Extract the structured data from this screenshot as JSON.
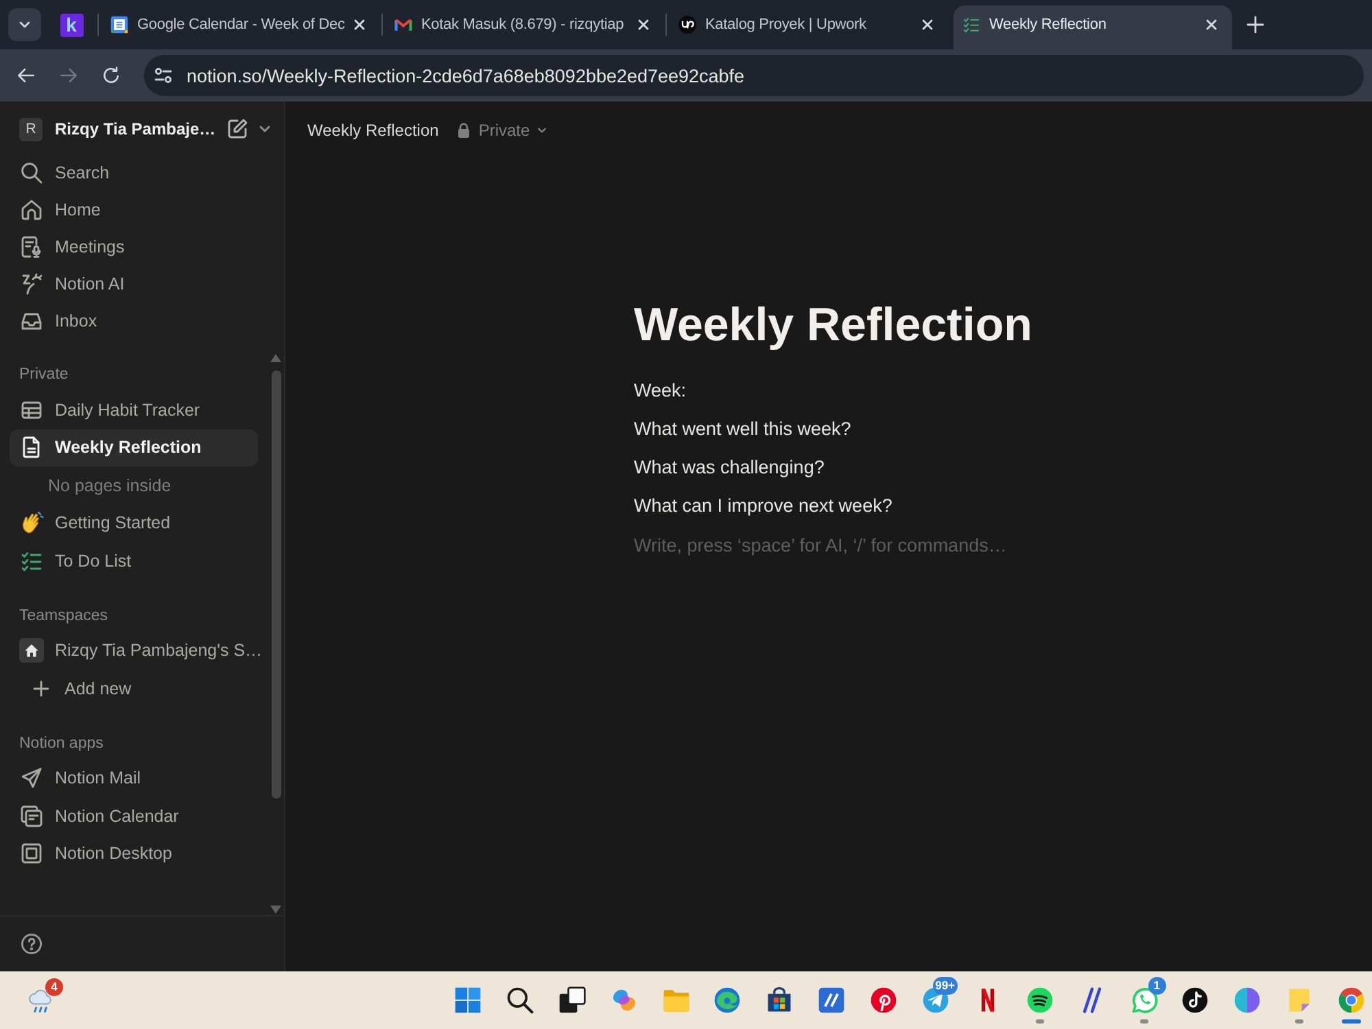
{
  "browser": {
    "tabs": [
      {
        "kind": "pinned",
        "logo_text": "k",
        "selected": false
      },
      {
        "kind": "page",
        "title": "Google Calendar - Week of Dec",
        "selected": false
      },
      {
        "kind": "page",
        "title": "Kotak Masuk (8.679) - rizqytiap",
        "selected": false
      },
      {
        "kind": "page",
        "title": "Katalog Proyek | Upwork",
        "selected": false
      },
      {
        "kind": "page",
        "title": "Weekly Reflection",
        "selected": true
      }
    ],
    "nav_buttons": [
      {
        "kind": "back",
        "disabled": false
      },
      {
        "kind": "forward",
        "disabled": true
      },
      {
        "kind": "reload",
        "disabled": false
      }
    ],
    "url": "notion.so/Weekly-Reflection-2cde6d7a68eb8092bbe2ed7ee92cabfe"
  },
  "sidebar": {
    "workspace": {
      "initial": "R",
      "name": "Rizqy Tia Pambaje…"
    },
    "nav": [
      {
        "label": "Search",
        "selected": false
      },
      {
        "label": "Home",
        "selected": false
      },
      {
        "label": "Meetings",
        "selected": false
      },
      {
        "label": "Notion AI",
        "selected": false
      },
      {
        "label": "Inbox",
        "selected": false
      }
    ],
    "sections": [
      {
        "title": "Private",
        "items": [
          {
            "kind": "entry",
            "label": "Daily Habit Tracker",
            "selected": false
          },
          {
            "kind": "entry",
            "label": "Weekly Reflection",
            "selected": true,
            "empty_note": "No pages inside"
          },
          {
            "kind": "entry",
            "label": "Getting Started",
            "selected": false
          },
          {
            "kind": "entry",
            "label": "To Do List",
            "selected": false
          }
        ]
      },
      {
        "title": "Teamspaces",
        "items": [
          {
            "kind": "entry",
            "label": "Rizqy Tia Pambajeng's S…",
            "selected": false
          },
          {
            "kind": "action",
            "label": "Add new",
            "selected": false
          }
        ]
      },
      {
        "title": "Notion apps",
        "items": [
          {
            "kind": "entry",
            "label": "Notion Mail",
            "selected": false
          },
          {
            "kind": "entry",
            "label": "Notion Calendar",
            "selected": false
          },
          {
            "kind": "entry",
            "label": "Notion Desktop",
            "selected": false
          }
        ]
      }
    ]
  },
  "header": {
    "breadcrumb": "Weekly Reflection",
    "visibility": "Private"
  },
  "page": {
    "title": "Weekly Reflection",
    "blocks": [
      "Week:",
      "What went well this week?",
      "What was challenging?",
      "What can I improve next week?"
    ],
    "placeholder": "Write, press ‘space’ for AI, ‘/’ for commands…"
  },
  "taskbar": {
    "weather": {
      "badge": "4"
    },
    "apps": [
      {
        "running": false,
        "focused": false
      },
      {
        "running": false,
        "focused": false
      },
      {
        "running": false,
        "focused": false
      },
      {
        "running": false,
        "focused": false
      },
      {
        "running": false,
        "focused": false
      },
      {
        "running": false,
        "focused": false
      },
      {
        "running": false,
        "focused": false
      },
      {
        "running": false,
        "focused": false
      },
      {
        "running": false,
        "focused": false
      },
      {
        "badge": "99+",
        "running": false,
        "focused": false
      },
      {
        "running": false,
        "focused": false
      },
      {
        "running": true,
        "focused": false
      },
      {
        "running": false,
        "focused": false
      },
      {
        "badge": "1",
        "running": true,
        "focused": false
      },
      {
        "running": false,
        "focused": false
      },
      {
        "running": false,
        "focused": false
      },
      {
        "running": true,
        "focused": false
      },
      {
        "running": true,
        "focused": true
      }
    ]
  }
}
